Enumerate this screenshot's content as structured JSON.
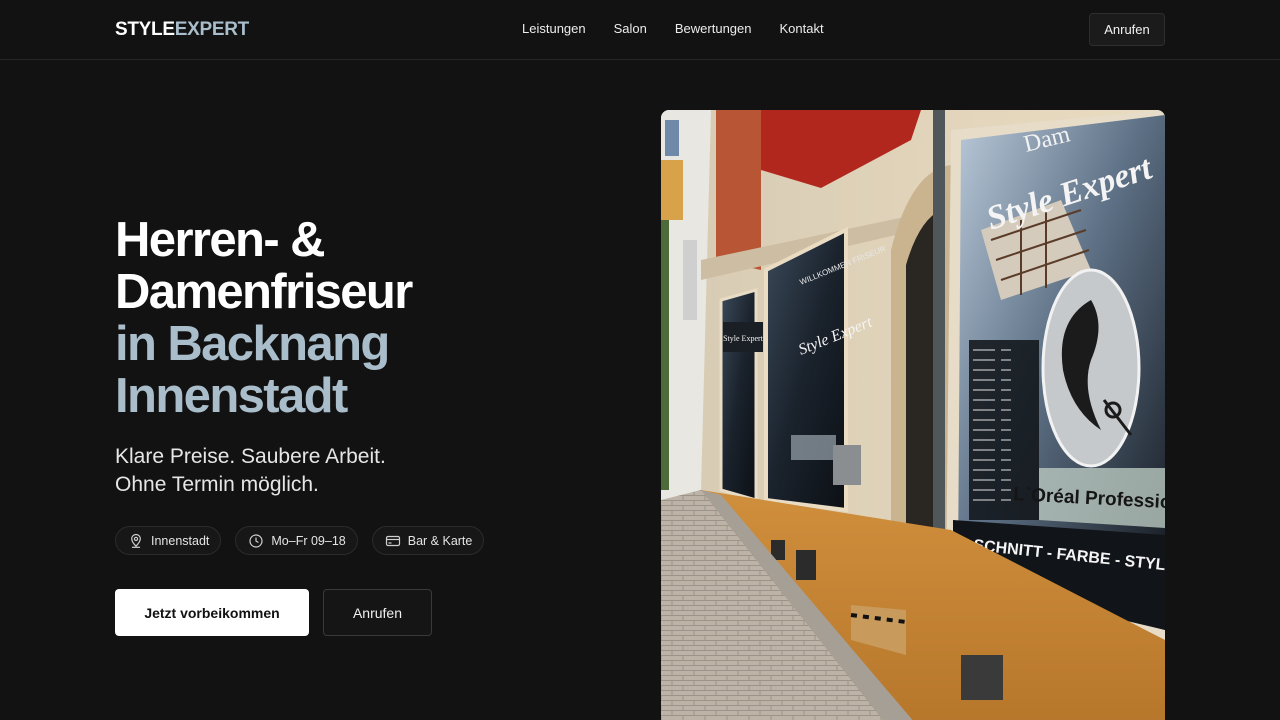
{
  "header": {
    "logo_part1": "STYLE",
    "logo_part2": "EXPERT",
    "nav": [
      "Leistungen",
      "Salon",
      "Bewertungen",
      "Kontakt"
    ],
    "call_label": "Anrufen"
  },
  "hero": {
    "headline": [
      "Herren- &",
      "Damenfriseur",
      "in Backnang",
      "Innenstadt"
    ],
    "subline": [
      "Klare Preise. Saubere Arbeit.",
      "Ohne Termin möglich."
    ],
    "chips": [
      {
        "icon": "location-pin-icon",
        "label": "Innenstadt"
      },
      {
        "icon": "clock-icon",
        "label": "Mo–Fr 09–18"
      },
      {
        "icon": "card-icon",
        "label": "Bar & Karte"
      }
    ],
    "primary_cta": "Jetzt vorbeikommen",
    "secondary_cta": "Anrufen"
  },
  "photo": {
    "sign_script": "Style Expert",
    "sign_top": "Dam",
    "brand_strip": "L`Oréal Professional",
    "services_strip": "SCHNITT - FARBE - STYLING - HAA",
    "small_sign": "Style Expert",
    "window_text": "Style Expert",
    "window_banner": "WILLKOMMEN FRISEUR"
  },
  "colors": {
    "background": "#121212",
    "accent": "#a9bdca",
    "text": "#ffffff"
  }
}
